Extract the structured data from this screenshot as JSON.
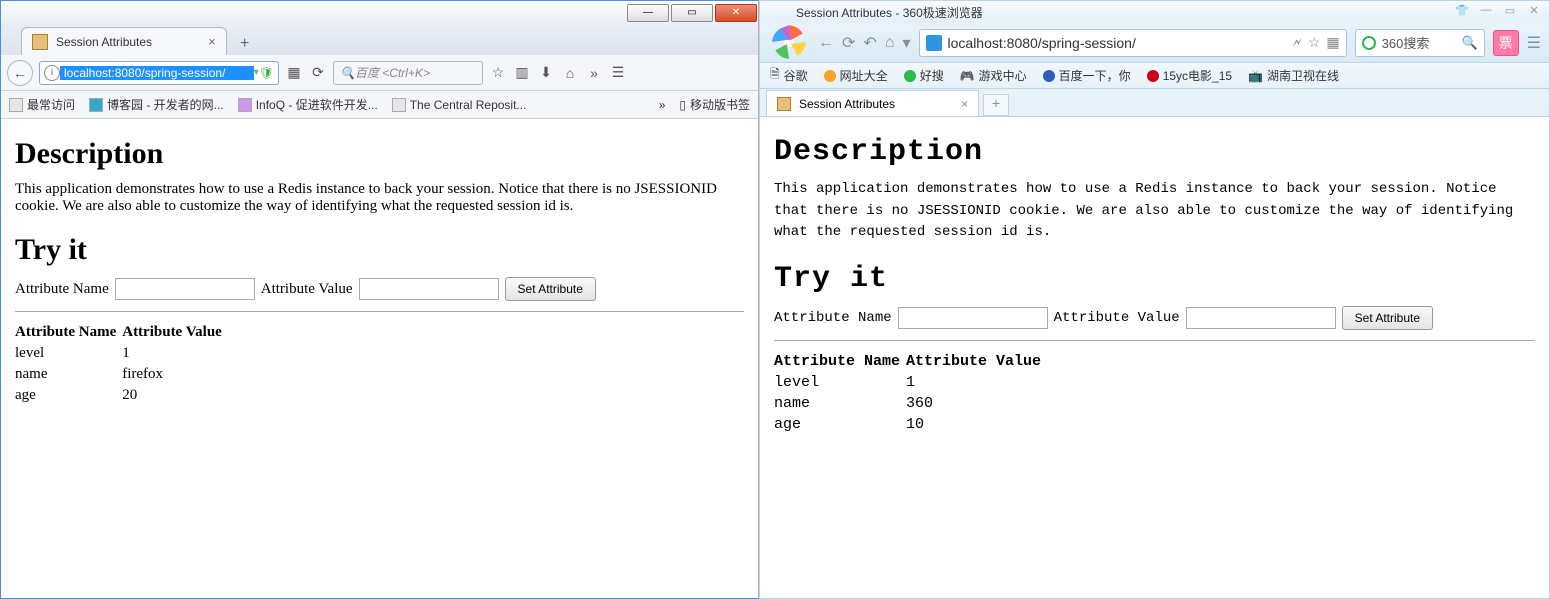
{
  "firefox": {
    "tab_title": "Session Attributes",
    "url": "localhost:8080/spring-session/",
    "search_placeholder": "百度 <Ctrl+K>",
    "bookmarks": [
      "最常访问",
      "博客园 - 开发者的网...",
      "InfoQ - 促进软件开发...",
      "The Central Reposit..."
    ],
    "bookmarks_right": "移动版书签",
    "page": {
      "h1a": "Description",
      "para": "This application demonstrates how to use a Redis instance to back your session. Notice that there is no JSESSIONID cookie. We are also able to customize the way of identifying what the requested session id is.",
      "h1b": "Try it",
      "lbl_name": "Attribute Name",
      "lbl_value": "Attribute Value",
      "btn": "Set Attribute",
      "th_name": "Attribute Name",
      "th_value": "Attribute Value",
      "rows": [
        {
          "k": "level",
          "v": "1"
        },
        {
          "k": "name",
          "v": "firefox"
        },
        {
          "k": "age",
          "v": "20"
        }
      ]
    }
  },
  "browser360": {
    "title": "Session Attributes - 360极速浏览器",
    "tab_title": "Session Attributes",
    "url": "localhost:8080/spring-session/",
    "search_label": "360搜索",
    "bookmarks": [
      "谷歌",
      "网址大全",
      "好搜",
      "游戏中心",
      "百度一下，你",
      "15yc电影_15",
      "湖南卫视在线"
    ],
    "page": {
      "h1a": "Description",
      "para": "This application demonstrates how to use a Redis instance to back your session. Notice that there is no JSESSIONID cookie. We are also able to customize the way of identifying what the requested session id is.",
      "h1b": "Try it",
      "lbl_name": "Attribute Name",
      "lbl_value": "Attribute Value",
      "btn": "Set Attribute",
      "th_name": "Attribute Name",
      "th_value": "Attribute Value",
      "rows": [
        {
          "k": "level",
          "v": "1"
        },
        {
          "k": "name",
          "v": "360"
        },
        {
          "k": "age",
          "v": "10"
        }
      ]
    }
  }
}
